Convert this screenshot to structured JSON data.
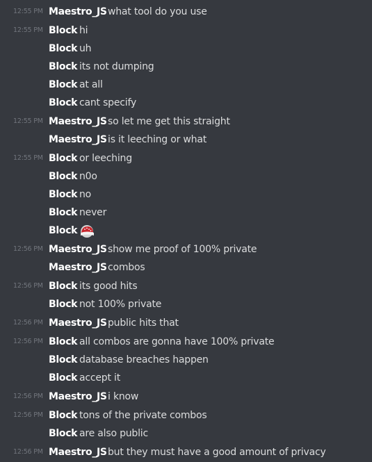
{
  "colors": {
    "background": "#36393f",
    "timestamp": "#72767d",
    "author": "#ffffff",
    "message_text": "#dcddde"
  },
  "messages": [
    {
      "time": "12:55 PM",
      "author": "Maestro_JS",
      "text": "what tool do you use"
    },
    {
      "time": "12:55 PM",
      "author": "Block",
      "text": "hi"
    },
    {
      "time": "",
      "author": "Block",
      "text": "uh"
    },
    {
      "time": "",
      "author": "Block",
      "text": "its not dumping"
    },
    {
      "time": "",
      "author": "Block",
      "text": "at all"
    },
    {
      "time": "",
      "author": "Block",
      "text": "cant specify"
    },
    {
      "time": "12:55 PM",
      "author": "Maestro_JS",
      "text": "so let me get this straight"
    },
    {
      "time": "",
      "author": "Maestro_JS",
      "text": "is it leeching or what"
    },
    {
      "time": "12:55 PM",
      "author": "Block",
      "text": "or leeching"
    },
    {
      "time": "",
      "author": "Block",
      "text": "n0o"
    },
    {
      "time": "",
      "author": "Block",
      "text": "no"
    },
    {
      "time": "",
      "author": "Block",
      "text": "never"
    },
    {
      "time": "",
      "author": "Block",
      "text": "",
      "emoji": "santa-hat-icon"
    },
    {
      "time": "12:56 PM",
      "author": "Maestro_JS",
      "text": "show me proof of 100% private"
    },
    {
      "time": "",
      "author": "Maestro_JS",
      "text": "combos"
    },
    {
      "time": "12:56 PM",
      "author": "Block",
      "text": "its good hits"
    },
    {
      "time": "",
      "author": "Block",
      "text": "not 100% private"
    },
    {
      "time": "12:56 PM",
      "author": "Maestro_JS",
      "text": "public hits that"
    },
    {
      "time": "12:56 PM",
      "author": "Block",
      "text": "all combos are gonna have 100% private"
    },
    {
      "time": "",
      "author": "Block",
      "text": "database breaches happen"
    },
    {
      "time": "",
      "author": "Block",
      "text": "accept it"
    },
    {
      "time": "12:56 PM",
      "author": "Maestro_JS",
      "text": "i know"
    },
    {
      "time": "12:56 PM",
      "author": "Block",
      "text": "tons of the private combos"
    },
    {
      "time": "",
      "author": "Block",
      "text": "are also public"
    },
    {
      "time": "12:56 PM",
      "author": "Maestro_JS",
      "text": "but they must have a good amount of privacy"
    }
  ]
}
